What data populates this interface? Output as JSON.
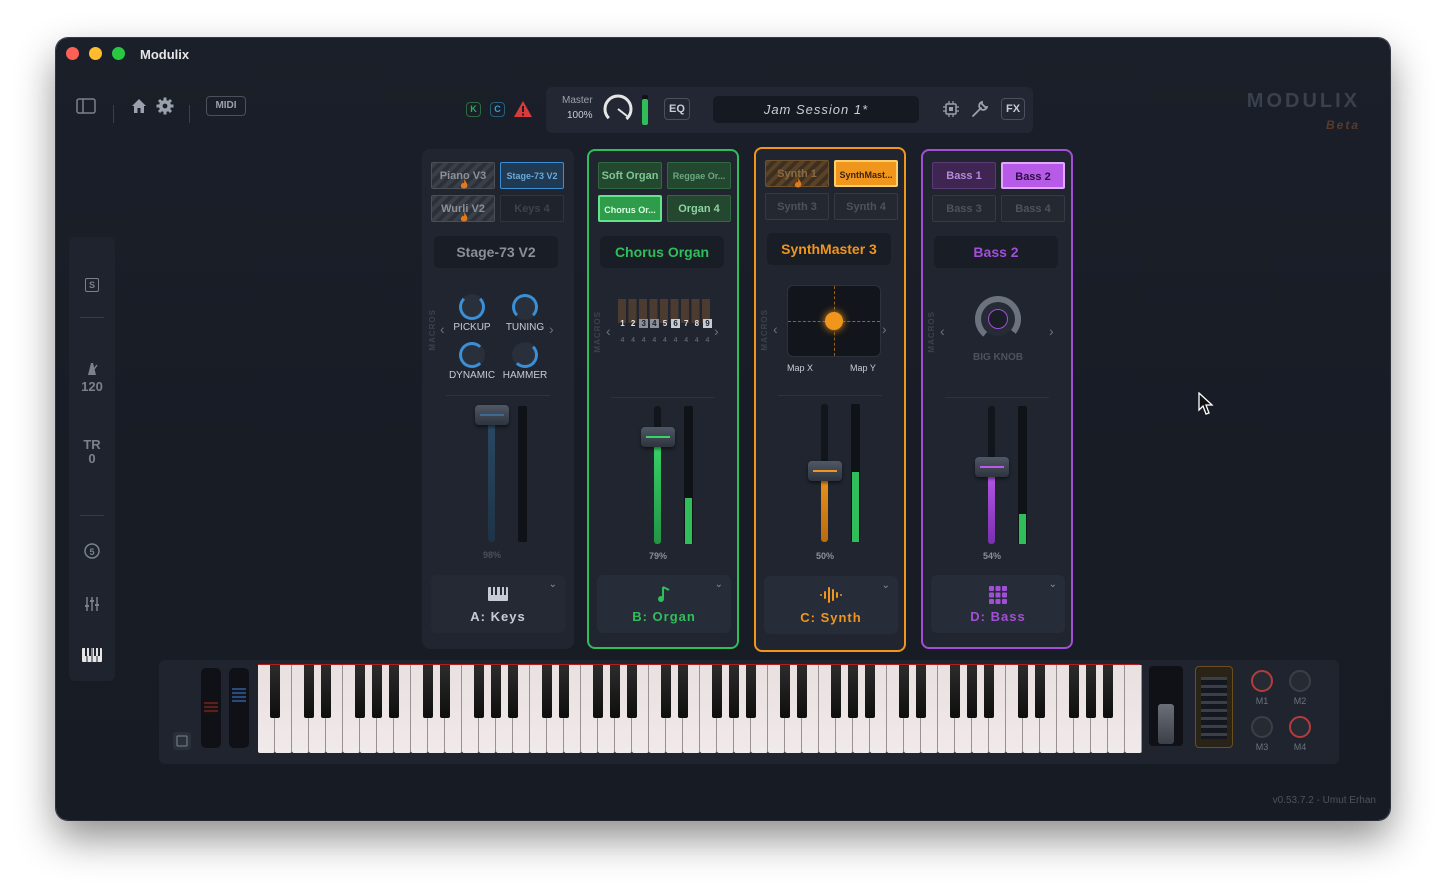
{
  "window": {
    "title": "Modulix"
  },
  "toolbar": {
    "midi_label": "MIDI",
    "k_badge": "K",
    "c_badge": "C"
  },
  "transport": {
    "master_label": "Master",
    "master_value": "100%",
    "eq_label": "EQ",
    "session_name": "Jam Session 1*",
    "fx_label": "FX"
  },
  "brand": {
    "name": "MODULIX",
    "tag": "Beta"
  },
  "sidebar": {
    "s_label": "S",
    "tempo": "120",
    "tr_label": "TR",
    "tr_value": "0"
  },
  "channels": [
    {
      "id": "A",
      "color": "#3b8fd6",
      "presets": [
        "Piano V3",
        "Stage-73 V2",
        "Wurli V2",
        "Keys 4"
      ],
      "patch_name": "Stage-73 V2",
      "macros_label": "MACROS",
      "knobs": [
        "PICKUP",
        "TUNING",
        "DYNAMIC",
        "HAMMER"
      ],
      "volume": "98%",
      "volume_level": 0.98,
      "footer": "A: Keys"
    },
    {
      "id": "B",
      "color": "#2fbe5a",
      "presets": [
        "Soft Organ",
        "Reggae Or...",
        "Chorus Or...",
        "Organ 4"
      ],
      "patch_name": "Chorus Organ",
      "macros_label": "MACROS",
      "drawbars": [
        "1",
        "2",
        "3",
        "4",
        "5",
        "6",
        "7",
        "8",
        "9"
      ],
      "drawbar_values": [
        "4",
        "4",
        "4",
        "4",
        "4",
        "4",
        "4",
        "4",
        "4"
      ],
      "volume": "79%",
      "volume_level": 0.79,
      "footer": "B: Organ"
    },
    {
      "id": "C",
      "color": "#f0961c",
      "presets": [
        "Synth 1",
        "SynthMast...",
        "Synth 3",
        "Synth 4"
      ],
      "patch_name": "SynthMaster 3",
      "macros_label": "MACROS",
      "xy_labels": [
        "Map X",
        "Map Y"
      ],
      "volume": "50%",
      "volume_level": 0.5,
      "footer": "C: Synth"
    },
    {
      "id": "D",
      "color": "#a14fd6",
      "presets": [
        "Bass 1",
        "Bass 2",
        "Bass 3",
        "Bass 4"
      ],
      "patch_name": "Bass 2",
      "macros_label": "MACROS",
      "big_knob_label": "BIG KNOB",
      "volume": "54%",
      "volume_level": 0.54,
      "footer": "D: Bass"
    }
  ],
  "keyboard": {
    "macro_knobs": [
      "M1",
      "M2",
      "M3",
      "M4"
    ]
  },
  "footer": {
    "version": "v0.53.7.2 - Umut Erhan"
  }
}
